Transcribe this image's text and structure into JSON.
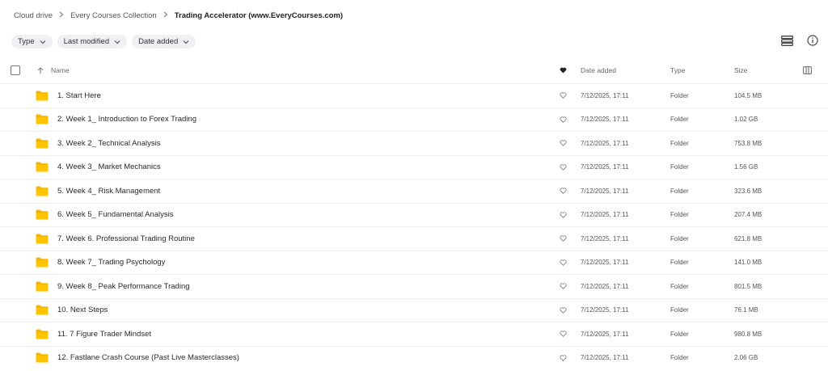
{
  "breadcrumb": {
    "items": [
      "Cloud drive",
      "Every Courses Collection"
    ],
    "current": "Trading Accelerator (www.EveryCourses.com)"
  },
  "filters": [
    "Type",
    "Last modified",
    "Date added"
  ],
  "columns": {
    "name": "Name",
    "date_added": "Date added",
    "type": "Type",
    "size": "Size"
  },
  "accent_folder_color": "#f5b400",
  "rows": [
    {
      "name": "1. Start Here",
      "date": "7/12/2025, 17:11",
      "type": "Folder",
      "size": "104.5 MB"
    },
    {
      "name": "2. Week 1_ Introduction to Forex Trading",
      "date": "7/12/2025, 17:11",
      "type": "Folder",
      "size": "1.02 GB"
    },
    {
      "name": "3. Week 2_ Technical Analysis",
      "date": "7/12/2025, 17:11",
      "type": "Folder",
      "size": "753.8 MB"
    },
    {
      "name": "4. Week 3_ Market Mechanics",
      "date": "7/12/2025, 17:11",
      "type": "Folder",
      "size": "1.56 GB"
    },
    {
      "name": "5. Week 4_ Risk Management",
      "date": "7/12/2025, 17:11",
      "type": "Folder",
      "size": "323.6 MB"
    },
    {
      "name": "6. Week 5_ Fundamental Analysis",
      "date": "7/12/2025, 17:11",
      "type": "Folder",
      "size": "207.4 MB"
    },
    {
      "name": "7. Week 6. Professional Trading Routine",
      "date": "7/12/2025, 17:11",
      "type": "Folder",
      "size": "621.8 MB"
    },
    {
      "name": "8. Week 7_ Trading Psychology",
      "date": "7/12/2025, 17:11",
      "type": "Folder",
      "size": "141.0 MB"
    },
    {
      "name": "9. Week 8_ Peak Performance Trading",
      "date": "7/12/2025, 17:11",
      "type": "Folder",
      "size": "801.5 MB"
    },
    {
      "name": "10. Next Steps",
      "date": "7/12/2025, 17:11",
      "type": "Folder",
      "size": "76.1 MB"
    },
    {
      "name": "11. 7 Figure Trader Mindset",
      "date": "7/12/2025, 17:11",
      "type": "Folder",
      "size": "980.8 MB"
    },
    {
      "name": "12. Fastlane Crash Course (Past Live Masterclasses)",
      "date": "7/12/2025, 17:11",
      "type": "Folder",
      "size": "2.06 GB"
    }
  ]
}
